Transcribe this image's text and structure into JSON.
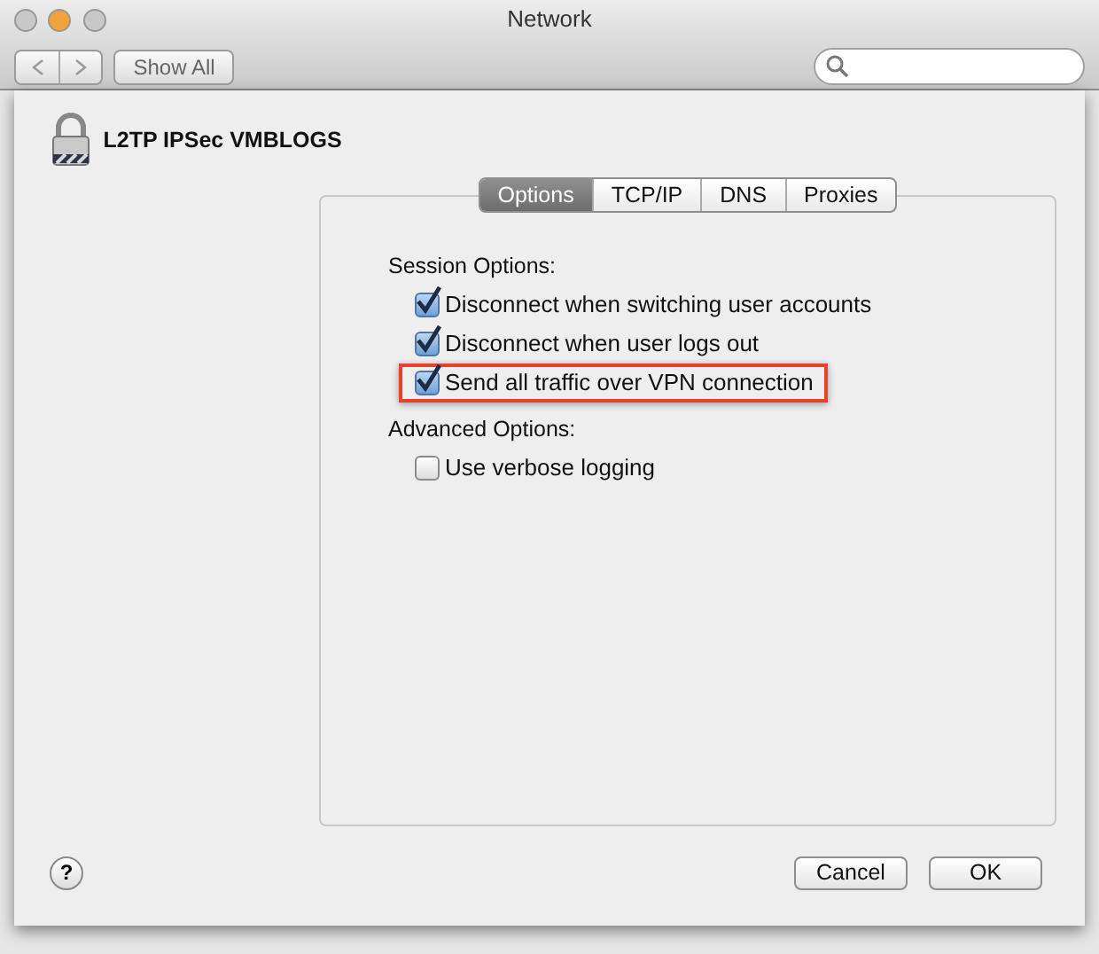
{
  "window": {
    "title": "Network",
    "show_all": "Show All"
  },
  "sheet": {
    "service_name": "L2TP IPSec VMBLOGS",
    "tabs": [
      {
        "label": "Options",
        "selected": true
      },
      {
        "label": "TCP/IP",
        "selected": false
      },
      {
        "label": "DNS",
        "selected": false
      },
      {
        "label": "Proxies",
        "selected": false
      }
    ],
    "sections": [
      {
        "heading": "Session Options:",
        "options": [
          {
            "label": "Disconnect when switching user accounts",
            "checked": true,
            "highlighted": false
          },
          {
            "label": "Disconnect when user logs out",
            "checked": true,
            "highlighted": false
          },
          {
            "label": "Send all traffic over VPN connection",
            "checked": true,
            "highlighted": true
          }
        ]
      },
      {
        "heading": "Advanced Options:",
        "options": [
          {
            "label": "Use verbose logging",
            "checked": false,
            "highlighted": false
          }
        ]
      }
    ],
    "help": "?",
    "buttons": [
      "Cancel",
      "OK"
    ]
  }
}
